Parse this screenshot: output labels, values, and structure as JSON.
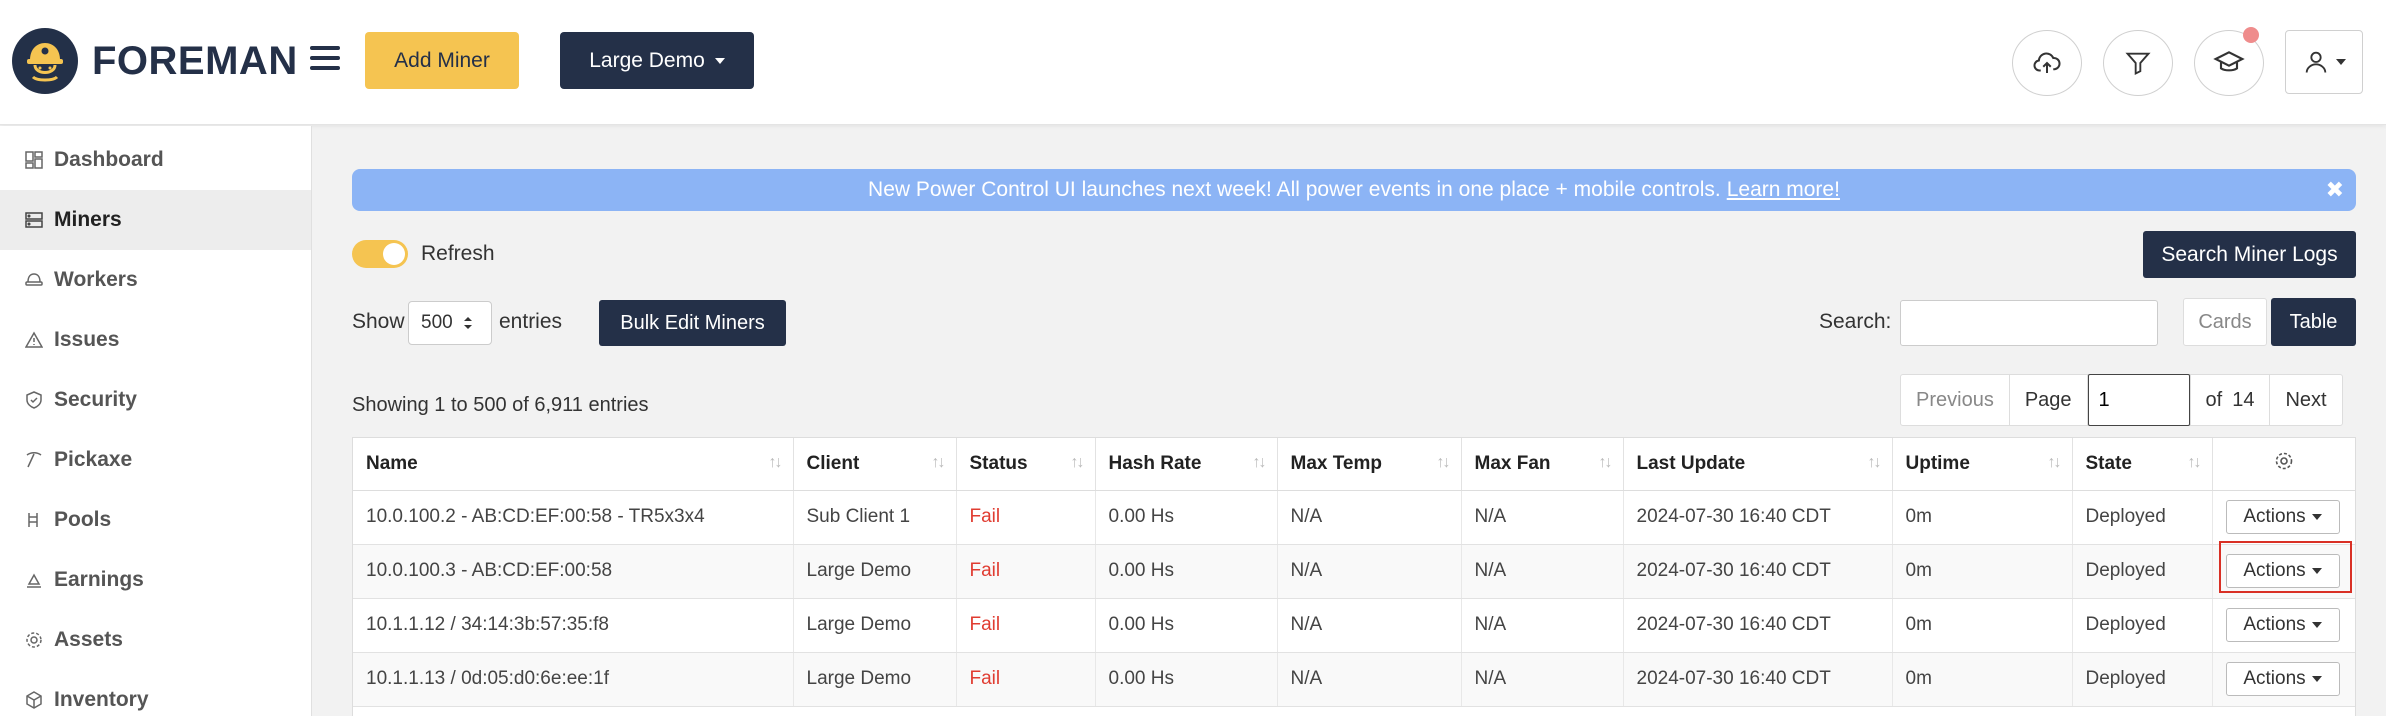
{
  "app": {
    "brand": "FOREMAN"
  },
  "header": {
    "add_miner_label": "Add Miner",
    "client_selector_label": "Large Demo"
  },
  "sidebar": {
    "items": [
      {
        "label": "Dashboard",
        "icon": "dashboard-icon"
      },
      {
        "label": "Miners",
        "icon": "miners-icon",
        "active": true
      },
      {
        "label": "Workers",
        "icon": "workers-icon"
      },
      {
        "label": "Issues",
        "icon": "warning-icon"
      },
      {
        "label": "Security",
        "icon": "shield-icon"
      },
      {
        "label": "Pickaxe",
        "icon": "pickaxe-icon"
      },
      {
        "label": "Pools",
        "icon": "pools-icon"
      },
      {
        "label": "Earnings",
        "icon": "earnings-icon"
      },
      {
        "label": "Assets",
        "icon": "gear-icon"
      },
      {
        "label": "Inventory",
        "icon": "inventory-icon"
      }
    ]
  },
  "banner": {
    "text": "New Power Control UI launches next week! All power events in one place + mobile controls.",
    "link": "Learn more!",
    "close": "✖"
  },
  "controls": {
    "refresh_label": "Refresh",
    "search_logs_label": "Search Miner Logs",
    "show_label": "Show",
    "entries_value": "500",
    "entries_label": "entries",
    "bulk_edit_label": "Bulk Edit Miners",
    "search_label": "Search:",
    "search_value": "",
    "view_cards_label": "Cards",
    "view_table_label": "Table",
    "showing_text": "Showing 1 to 500 of 6,911 entries"
  },
  "pager": {
    "previous": "Previous",
    "page_label": "Page",
    "page_value": "1",
    "of_label": "of",
    "total_pages": "14",
    "next": "Next"
  },
  "table": {
    "columns": [
      "Name",
      "Client",
      "Status",
      "Hash Rate",
      "Max Temp",
      "Max Fan",
      "Last Update",
      "Uptime",
      "State"
    ],
    "action_label": "Actions",
    "rows": [
      {
        "name": "10.0.100.2 - AB:CD:EF:00:58 - TR5x3x4",
        "client": "Sub Client 1",
        "status": "Fail",
        "hash_rate": "0.00 Hs",
        "max_temp": "N/A",
        "max_fan": "N/A",
        "last_update": "2024-07-30 16:40 CDT",
        "uptime": "0m",
        "state": "Deployed"
      },
      {
        "name": "10.0.100.3 - AB:CD:EF:00:58",
        "client": "Large Demo",
        "status": "Fail",
        "hash_rate": "0.00 Hs",
        "max_temp": "N/A",
        "max_fan": "N/A",
        "last_update": "2024-07-30 16:40 CDT",
        "uptime": "0m",
        "state": "Deployed"
      },
      {
        "name": "10.1.1.12 / 34:14:3b:57:35:f8",
        "client": "Large Demo",
        "status": "Fail",
        "hash_rate": "0.00 Hs",
        "max_temp": "N/A",
        "max_fan": "N/A",
        "last_update": "2024-07-30 16:40 CDT",
        "uptime": "0m",
        "state": "Deployed"
      },
      {
        "name": "10.1.1.13 / 0d:05:d0:6e:ee:1f",
        "client": "Large Demo",
        "status": "Fail",
        "hash_rate": "0.00 Hs",
        "max_temp": "N/A",
        "max_fan": "N/A",
        "last_update": "2024-07-30 16:40 CDT",
        "uptime": "0m",
        "state": "Deployed"
      }
    ]
  },
  "colors": {
    "brand_navy": "#243048",
    "accent_yellow": "#f5c451",
    "banner_blue": "#8cb4f5",
    "fail_red": "#e03c31"
  }
}
